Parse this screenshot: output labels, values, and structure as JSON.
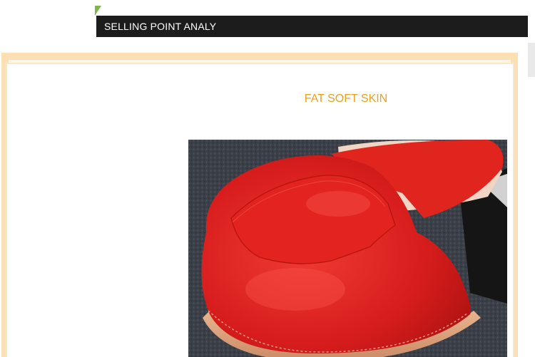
{
  "header": {
    "title": "SELLING POINT ANALY"
  },
  "section": {
    "title": "FAT SOFT SKIN"
  },
  "product_image": {
    "subject": "red-leather-loafer-toe",
    "colors": {
      "shoe": "#e2231f",
      "carpet": "#3c4049",
      "insole": "#f3d6c6"
    }
  },
  "colors": {
    "header_bg": "#1c1c1c",
    "header_text": "#ffffff",
    "title_accent": "#e8a11c",
    "frame_border": "#fce0b4"
  }
}
